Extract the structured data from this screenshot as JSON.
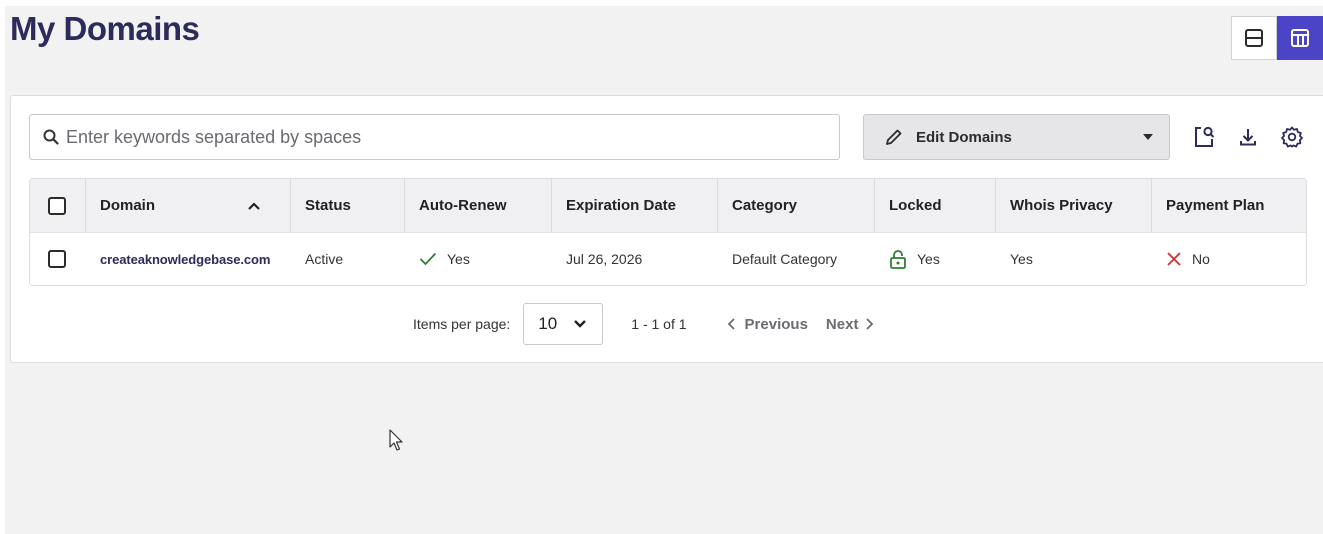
{
  "page": {
    "title": "My Domains"
  },
  "colors": {
    "brand": "#2d2b5c",
    "accent": "#4b44c6",
    "check": "#2e7d32",
    "cross": "#d32f2f"
  },
  "view_toggle": [
    {
      "name": "list-view-icon",
      "active": false
    },
    {
      "name": "table-view-icon",
      "active": true
    }
  ],
  "toolbar": {
    "search_placeholder": "Enter keywords separated by spaces",
    "search_value": "",
    "edit_label": "Edit Domains",
    "icons": [
      "search-report-icon",
      "download-icon",
      "settings-icon"
    ]
  },
  "table": {
    "columns": [
      "Domain",
      "Status",
      "Auto-Renew",
      "Expiration Date",
      "Category",
      "Locked",
      "Whois Privacy",
      "Payment Plan"
    ],
    "sort": {
      "column": "Domain",
      "direction": "asc"
    },
    "rows": [
      {
        "domain": "createaknowledgebase.com",
        "status": "Active",
        "auto_renew": "Yes",
        "expiration": "Jul 26, 2026",
        "category": "Default Category",
        "locked": "Yes",
        "whois": "Yes",
        "payment_plan": "No"
      }
    ]
  },
  "pagination": {
    "items_label": "Items per page:",
    "per_page": "10",
    "range": "1 - 1 of 1",
    "previous": "Previous",
    "next": "Next"
  }
}
